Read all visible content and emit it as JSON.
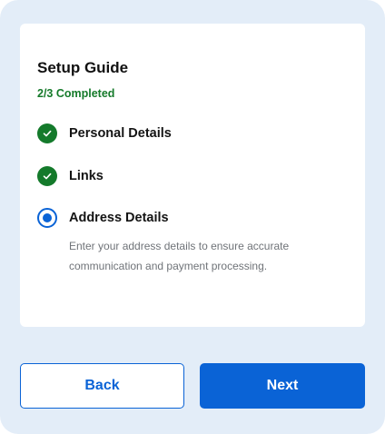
{
  "setup_guide": {
    "title": "Setup Guide",
    "progress": "2/3 Completed",
    "steps": [
      {
        "label": "Personal Details",
        "status": "completed",
        "icon": "check-icon"
      },
      {
        "label": "Links",
        "status": "completed",
        "icon": "check-icon"
      },
      {
        "label": "Address Details",
        "status": "current",
        "icon": "radio-selected-icon",
        "description": "Enter your address details to ensure accurate communication and payment processing."
      }
    ]
  },
  "footer": {
    "back_label": "Back",
    "next_label": "Next"
  },
  "colors": {
    "accent": "#0a63d6",
    "success": "#147a2b",
    "background": "#e3edf8"
  }
}
